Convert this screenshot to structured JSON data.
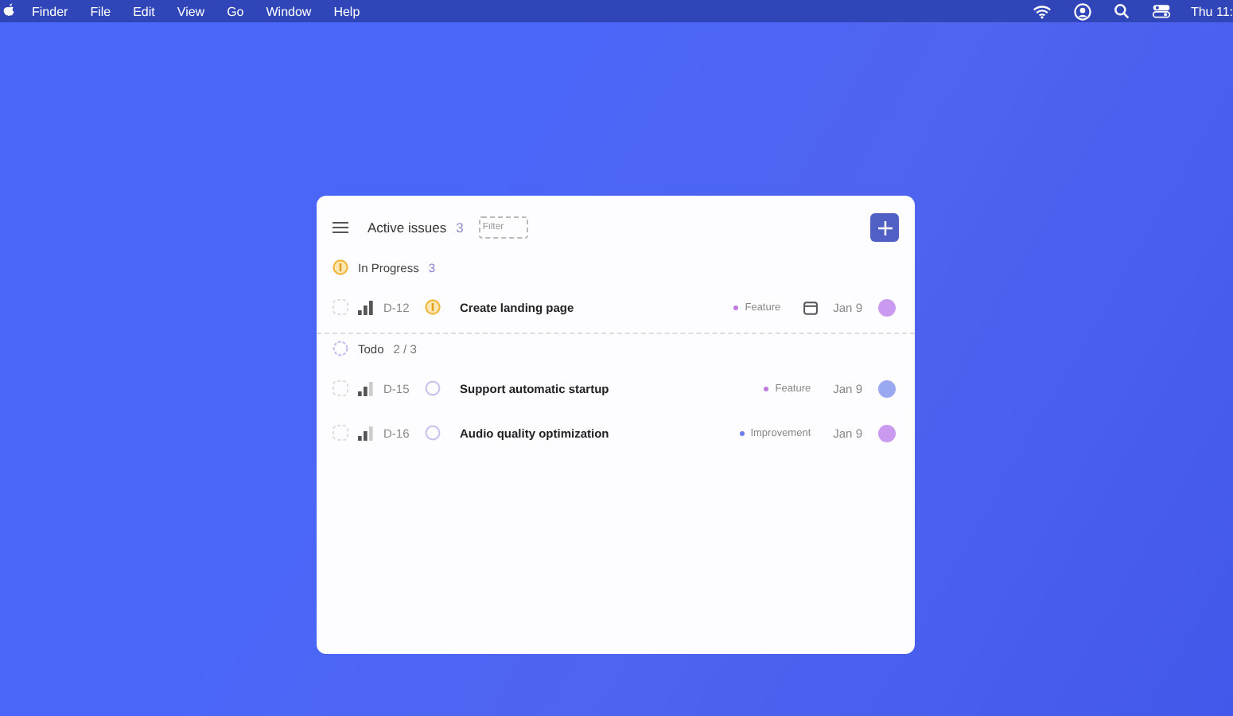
{
  "menu_bar": {
    "items": [
      "Finder",
      "File",
      "Edit",
      "View",
      "Go",
      "Window",
      "Help"
    ],
    "clock": "Thu 11:"
  },
  "panel": {
    "title": "Active issues",
    "count": "3",
    "filter": {
      "placeholder": "Filter"
    },
    "groups": [
      {
        "name": "In Progress",
        "status_icon": {
          "kind": "in_progress"
        },
        "count": "3",
        "issues": [
          {
            "id": "D-12",
            "priority": {
              "level": 1
            },
            "status_icon": {
              "kind": "in_progress"
            },
            "title": "Create landing page",
            "label": {
              "text": "Feature",
              "color": "#c07be0"
            },
            "has_due_icon": true,
            "date": "Jan 9",
            "avatar": {
              "color": "#c99af0"
            }
          }
        ]
      },
      {
        "name": "Todo",
        "status_icon": {
          "kind": "todo"
        },
        "count": "2 / 3",
        "issues": [
          {
            "id": "D-15",
            "priority": {
              "level": 0.67
            },
            "status_icon": {
              "kind": "todo"
            },
            "title": "Support automatic startup",
            "label": {
              "text": "Feature",
              "color": "#c07be0"
            },
            "has_due_icon": false,
            "date": "Jan 9",
            "avatar": {
              "color": "#9aa8f2"
            }
          },
          {
            "id": "D-16",
            "priority": {
              "level": 0.67
            },
            "status_icon": {
              "kind": "todo"
            },
            "title": "Audio quality optimization",
            "label": {
              "text": "Improvement",
              "color": "#6b7fe8"
            },
            "has_due_icon": false,
            "date": "Jan 9",
            "avatar": {
              "color": "#c99af0"
            }
          }
        ]
      }
    ]
  }
}
